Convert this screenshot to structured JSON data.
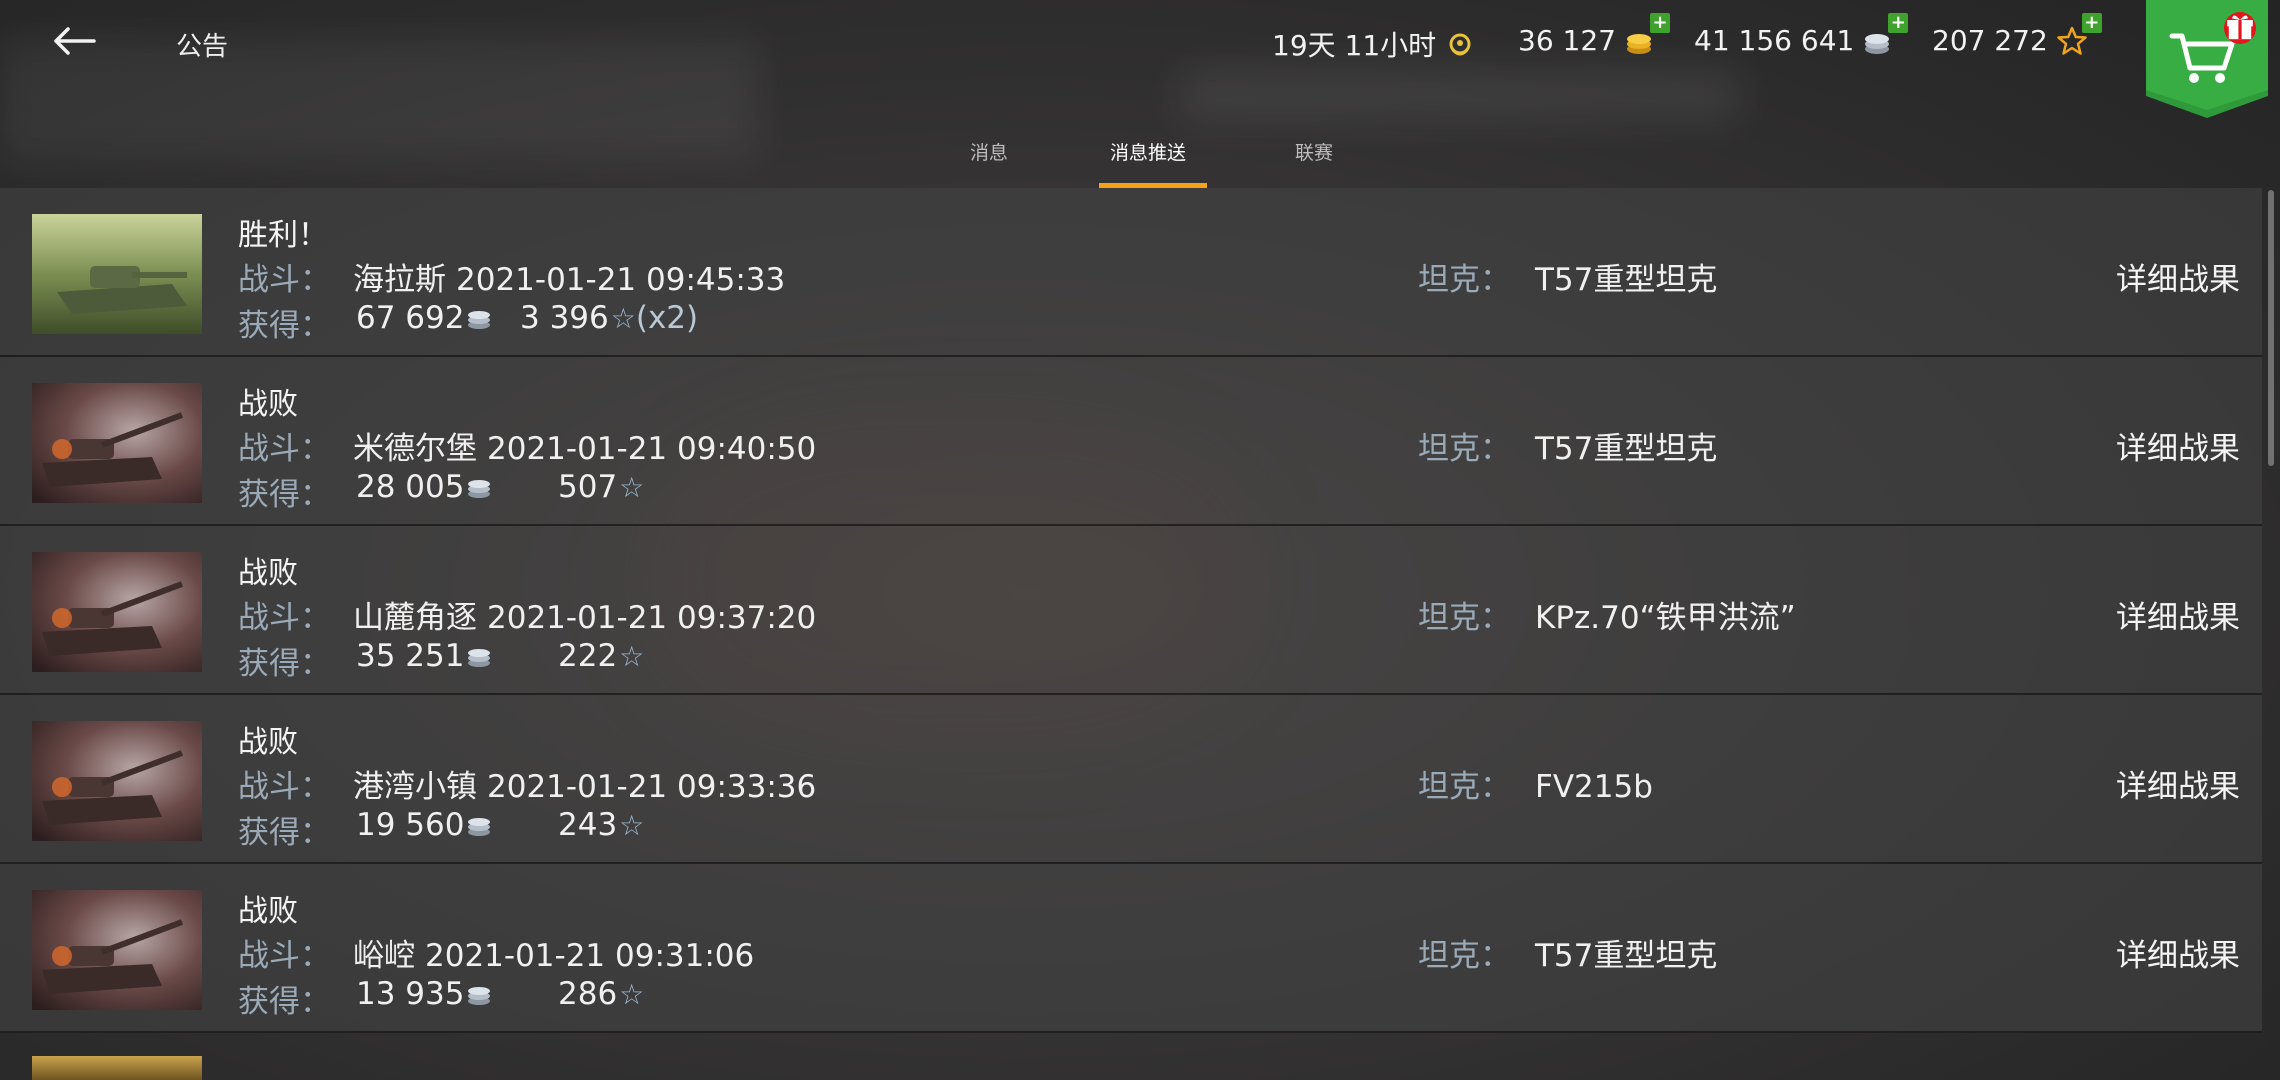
{
  "header": {
    "title": "公告",
    "timer": "19天 11小时",
    "gold": "36 127",
    "credits": "41 156 641",
    "free_xp": "207 272"
  },
  "tabs": [
    {
      "label": "消息",
      "active": false
    },
    {
      "label": "消息推送",
      "active": true
    },
    {
      "label": "联赛",
      "active": false
    }
  ],
  "labels": {
    "battle": "战斗：",
    "earned": "获得：",
    "tank": "坦克：",
    "details": "详细战果"
  },
  "icons": {
    "back": "arrow-left-icon",
    "premium": "premium-laurel-icon",
    "gold": "gold-coins-icon",
    "credits": "silver-coins-icon",
    "free_xp": "star-icon",
    "shop": "cart-icon",
    "gift": "gift-icon"
  },
  "colors": {
    "accent": "#f5a21a",
    "plus": "#3fa22c",
    "shop": "#2f9a3a",
    "badge": "#e2161c",
    "label": "#9aaab8"
  },
  "battles": [
    {
      "result": "胜利！",
      "victory": true,
      "map": "海拉斯",
      "datetime": "2021-01-21 09:45:33",
      "credits": "67 692",
      "xp": "3 396",
      "multiplier": "(x2)",
      "tank": "T57重型坦克"
    },
    {
      "result": "战败",
      "victory": false,
      "map": "米德尔堡",
      "datetime": "2021-01-21 09:40:50",
      "credits": "28 005",
      "xp": "507",
      "multiplier": "",
      "tank": "T57重型坦克"
    },
    {
      "result": "战败",
      "victory": false,
      "map": "山麓角逐",
      "datetime": "2021-01-21 09:37:20",
      "credits": "35 251",
      "xp": "222",
      "multiplier": "",
      "tank": "KPz.70“铁甲洪流”"
    },
    {
      "result": "战败",
      "victory": false,
      "map": "港湾小镇",
      "datetime": "2021-01-21 09:33:36",
      "credits": "19 560",
      "xp": "243",
      "multiplier": "",
      "tank": "FV215b"
    },
    {
      "result": "战败",
      "victory": false,
      "map": "峪崆",
      "datetime": "2021-01-21 09:31:06",
      "credits": "13 935",
      "xp": "286",
      "multiplier": "",
      "tank": "T57重型坦克"
    }
  ]
}
